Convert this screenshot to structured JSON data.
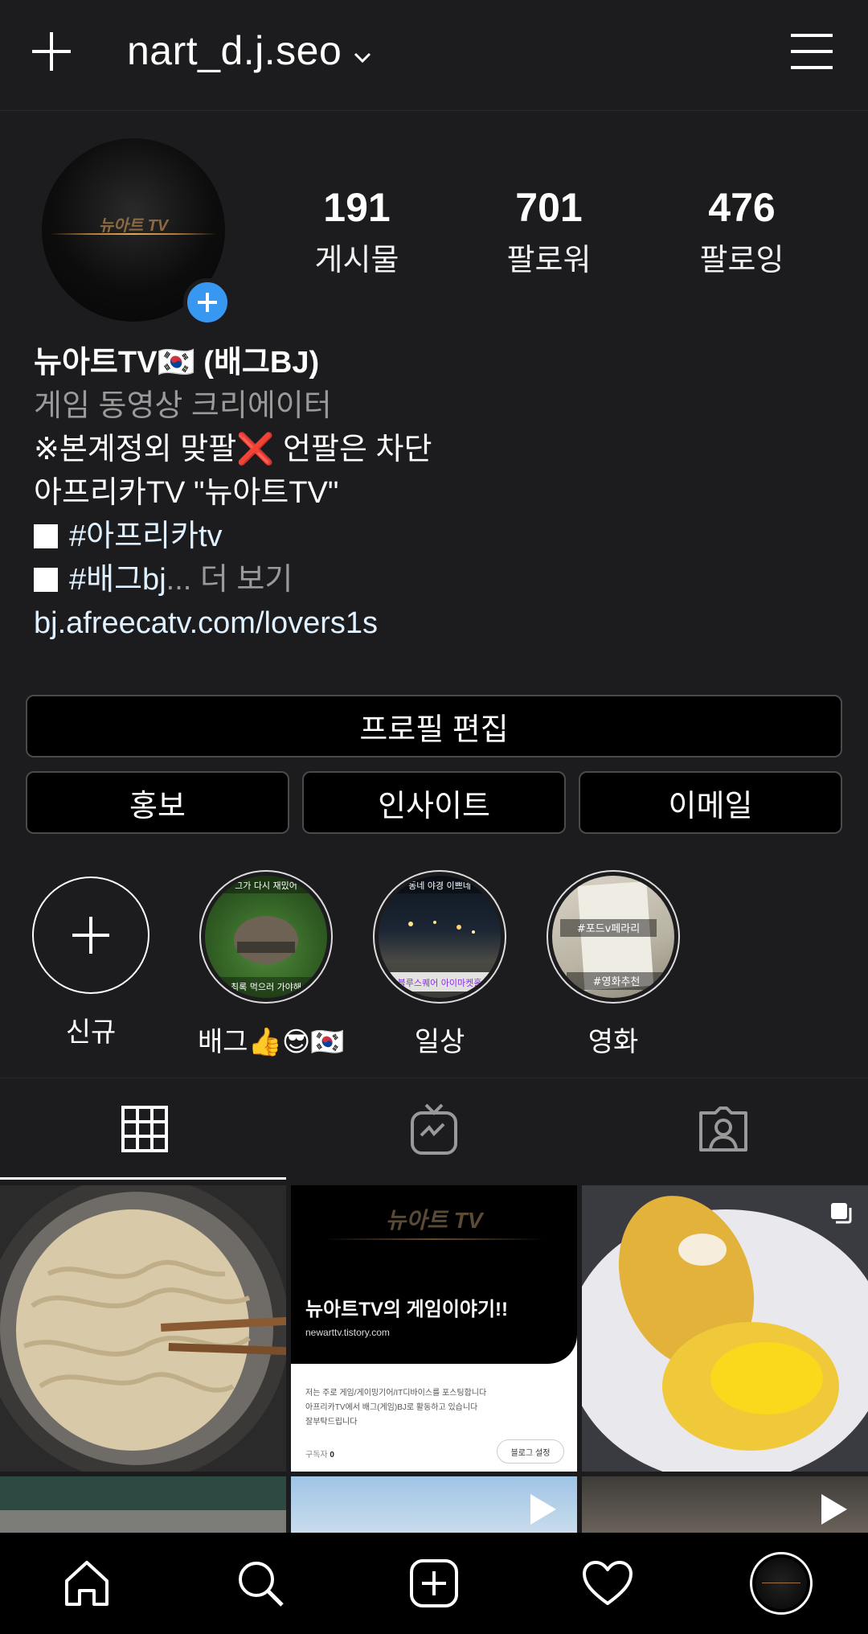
{
  "header": {
    "username": "nart_d.j.seo",
    "icons": [
      "plus-icon",
      "chevron-down-icon",
      "hamburger-menu-icon"
    ]
  },
  "profile": {
    "avatar_logo": "뉴아트 TV",
    "stats": [
      {
        "value": "191",
        "label": "게시물"
      },
      {
        "value": "701",
        "label": "팔로워"
      },
      {
        "value": "476",
        "label": "팔로잉"
      }
    ]
  },
  "bio": {
    "name": "뉴아트TV🇰🇷 (배그BJ)",
    "category": "게임 동영상 크리에이터",
    "line1_a": "※본계정외 맞팔",
    "line1_x": "❌",
    "line1_b": " 언팔은 차단",
    "line2": "아프리카TV \"뉴아트TV\"",
    "tag1": "#아프리카tv",
    "tag2": "#배그bj",
    "ellipsis": "...",
    "more": " 더 보기",
    "link": "bj.afreecatv.com/lovers1s"
  },
  "buttons": {
    "edit_profile": "프로필 편집",
    "promote": "홍보",
    "insights": "인사이트",
    "email": "이메일"
  },
  "highlights": [
    {
      "label": "신규"
    },
    {
      "label": "배그👍😎🇰🇷",
      "top_text": "그가 다시 재밌어",
      "bottom_text": "최록 먹으러 가야해"
    },
    {
      "label": "일상",
      "top_text": "동네 야경 이쁘네",
      "bottom_text": "블루스퀘어 아이마켓홀"
    },
    {
      "label": "영화",
      "top_text": "#포드v페라리",
      "bottom_text": "#영화추천"
    }
  ],
  "tabs": [
    "grid-tab",
    "igtv-tab",
    "tagged-tab"
  ],
  "posts": {
    "blog_logo": "뉴아트 TV",
    "blog_title": "뉴아트TV의 게임이야기!!",
    "blog_url": "newarttv.tistory.com",
    "blog_desc1": "저는 주로 게임/게이밍기어/IT디바이스를 포스팅합니다",
    "blog_desc2": "아프리카TV에서 배그(게임)BJ로 활동하고 있습니다",
    "blog_desc3": "잘부탁드립니다",
    "blog_subs_label": "구독자",
    "blog_subs_value": "0",
    "blog_settings": "블로그 설정"
  },
  "colors": {
    "background": "#1c1c1e",
    "accent_blue": "#3897f0",
    "link": "#e0f1ff",
    "muted": "#9a9a9a"
  }
}
